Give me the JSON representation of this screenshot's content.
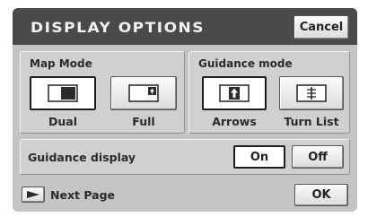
{
  "header": {
    "title": "DISPLAY OPTIONS",
    "cancel_label": "Cancel"
  },
  "map_mode": {
    "label": "Map Mode",
    "options": [
      {
        "label": "Dual",
        "icon": "dual-screen-icon",
        "selected": true
      },
      {
        "label": "Full",
        "icon": "full-screen-icon",
        "selected": false
      }
    ]
  },
  "guidance_mode": {
    "label": "Guidance mode",
    "options": [
      {
        "label": "Arrows",
        "icon": "arrow-guidance-icon",
        "selected": true
      },
      {
        "label": "Turn List",
        "icon": "turn-list-icon",
        "selected": false
      }
    ]
  },
  "guidance_display": {
    "label": "Guidance display",
    "on_label": "On",
    "off_label": "Off",
    "selected": "On"
  },
  "footer": {
    "next_page_label": "Next Page",
    "ok_label": "OK"
  },
  "colors": {
    "header_bg": "#4a4a4a",
    "screen_bg": "#c4c4c4",
    "panel_bg": "#d0d0d0",
    "selected_border": "#1e1e1e"
  }
}
